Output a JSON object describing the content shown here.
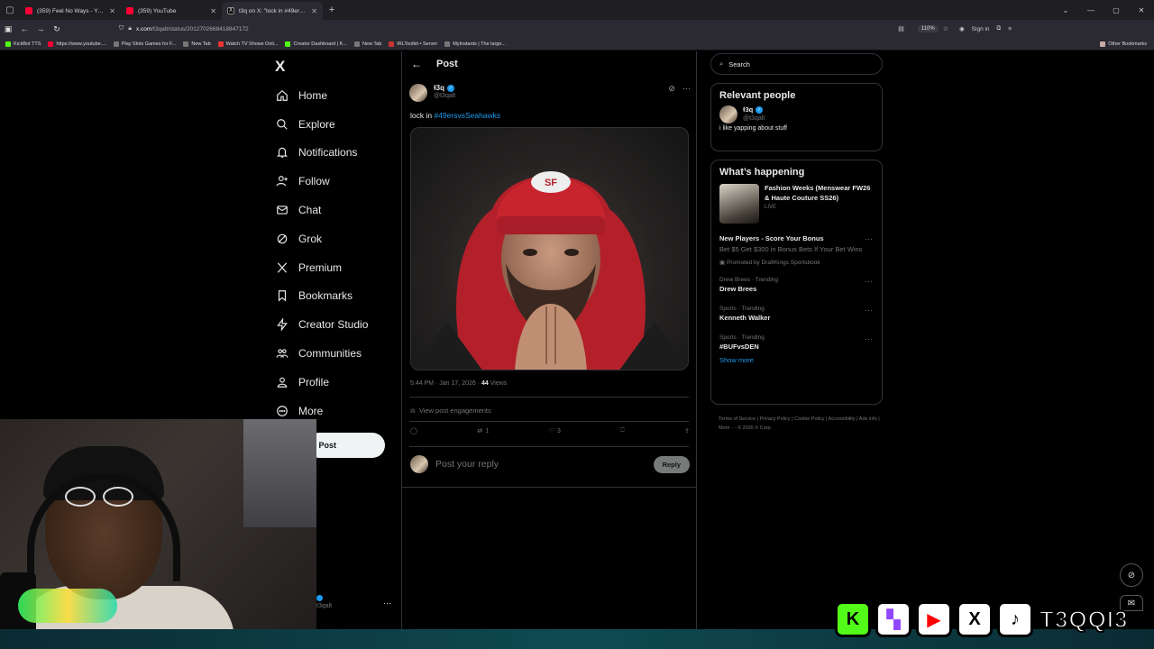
{
  "browser": {
    "tabs": [
      {
        "title": "(359) Feel No Ways - YouTu",
        "favicon": "youtube-icon",
        "active": false
      },
      {
        "title": "(359) YouTube",
        "favicon": "youtube-icon",
        "active": false
      },
      {
        "title": "t3q on X: \"lock in #49ersvsSea",
        "favicon": "x-icon",
        "active": true
      }
    ],
    "url_host": "x.com",
    "url_path": "/t3qalt/status/2012702668418847172",
    "zoom": "110%",
    "sign_in": "Sign in",
    "bookmarks": [
      "KickBot TTS",
      "https://www.youtube....",
      "Play Slots Games for F...",
      "New Tab",
      "Watch TV Shows Onli...",
      "Creator Dashboard | K...",
      "New Tab",
      "IRLToolkit • Server",
      "MyInstants | The large..."
    ],
    "other_bookmarks": "Other Bookmarks"
  },
  "nav": {
    "logo": "X",
    "items": [
      {
        "label": "Home",
        "icon": "home-icon"
      },
      {
        "label": "Explore",
        "icon": "search-icon"
      },
      {
        "label": "Notifications",
        "icon": "bell-icon"
      },
      {
        "label": "Follow",
        "icon": "follow-icon"
      },
      {
        "label": "Chat",
        "icon": "mail-icon"
      },
      {
        "label": "Grok",
        "icon": "grok-icon"
      },
      {
        "label": "Premium",
        "icon": "x-icon"
      },
      {
        "label": "Bookmarks",
        "icon": "bookmark-icon"
      },
      {
        "label": "Creator Studio",
        "icon": "lightning-icon"
      },
      {
        "label": "Communities",
        "icon": "people-icon"
      },
      {
        "label": "Profile",
        "icon": "person-icon"
      },
      {
        "label": "More",
        "icon": "more-circle-icon"
      }
    ],
    "post_button": "Post",
    "account_more": "···"
  },
  "post": {
    "header_title": "Post",
    "author_name": "ɫ3q",
    "author_handle": "@t3qalt",
    "text_prefix": "lock in ",
    "hashtag": "#49ersvsSeahawks",
    "time": "5:44 PM · Jan 17, 2026 · ",
    "views_count": "44",
    "views_label": " Views",
    "engagements_label": "View post engagements",
    "reposts": "1",
    "likes": "3",
    "reply_placeholder": "Post your reply",
    "reply_button": "Reply"
  },
  "sidebar": {
    "search_placeholder": "Search",
    "relevant_title": "Relevant people",
    "person": {
      "name": "ɫ3q",
      "handle": "@t3qalt",
      "bio": "i like yapping about stuff"
    },
    "happening_title": "What’s happening",
    "featured": {
      "title": "Fashion Weeks (Menswear FW26 & Haute Couture SS26)",
      "status": "LIVE"
    },
    "promo": {
      "title": "New Players - Score Your Bonus",
      "desc": "Bet $5 Get $300 in Bonus Bets If Your Bet Wins",
      "by": "Promoted by DraftKings Sportsbook"
    },
    "trends": [
      {
        "context": "Drew Brees · Trending",
        "title": "Drew Brees"
      },
      {
        "context": "Sports · Trending",
        "title": "Kenneth Walker"
      },
      {
        "context": "Sports · Trending",
        "title": "#BUFvsDEN"
      }
    ],
    "show_more": "Show more",
    "footer": "Terms of Service  |  Privacy Policy  |  Cookie Policy  |  Accessibility  |  Ads info  |  More ···  © 2026 X Corp."
  },
  "account_peek": {
    "handle": "t3qalt"
  },
  "overlay": {
    "brand": "T3QQI3"
  }
}
